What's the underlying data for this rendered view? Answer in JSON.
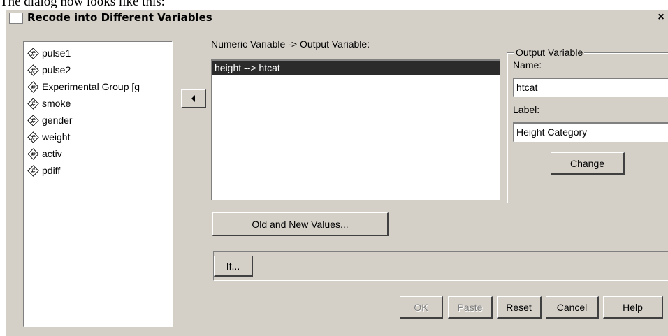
{
  "doc": {
    "caption": "The dialog now looks like this:"
  },
  "window": {
    "title": "Recode into Different Variables",
    "close_label": "×"
  },
  "source_variables": [
    {
      "label": "pulse1",
      "icon": "numeric-variable-icon"
    },
    {
      "label": "pulse2",
      "icon": "numeric-variable-icon"
    },
    {
      "label": "Experimental Group [g",
      "icon": "numeric-variable-icon"
    },
    {
      "label": "smoke",
      "icon": "numeric-variable-icon"
    },
    {
      "label": "gender",
      "icon": "numeric-variable-icon"
    },
    {
      "label": "weight",
      "icon": "numeric-variable-icon"
    },
    {
      "label": "activ",
      "icon": "numeric-variable-icon"
    },
    {
      "label": "pdiff",
      "icon": "numeric-variable-icon"
    }
  ],
  "numeric_output": {
    "heading": "Numeric Variable -> Output Variable:",
    "items": [
      "height --> htcat"
    ]
  },
  "output_variable": {
    "group_title": "Output Variable",
    "name_label": "Name:",
    "name_value": "htcat",
    "label_label": "Label:",
    "label_value": "Height Category",
    "change_label": "Change"
  },
  "buttons": {
    "old_new_values": "Old and New Values...",
    "if": "If...",
    "ok": "OK",
    "paste": "Paste",
    "reset": "Reset",
    "cancel": "Cancel",
    "help": "Help"
  },
  "colors": {
    "dialog_bg": "#d4d0c8",
    "selection_bg": "#2b2b2b",
    "selection_fg": "#ffffff"
  }
}
